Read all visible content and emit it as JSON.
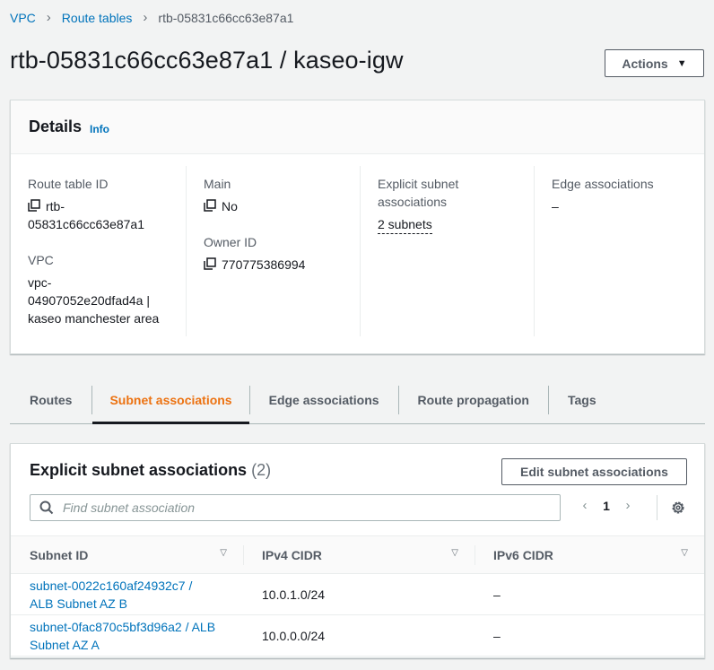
{
  "breadcrumb": {
    "items": [
      "VPC",
      "Route tables"
    ],
    "current": "rtb-05831c66cc63e87a1"
  },
  "page": {
    "title": "rtb-05831c66cc63e87a1 / kaseo-igw",
    "actions_label": "Actions"
  },
  "details": {
    "heading": "Details",
    "info_label": "Info",
    "route_table_id_label": "Route table ID",
    "route_table_id_line1": "rtb-",
    "route_table_id_line2": "05831c66cc63e87a1",
    "vpc_label": "VPC",
    "vpc_line1": "vpc-",
    "vpc_line2": "04907052e20dfad4a |",
    "vpc_line3": "kaseo manchester area",
    "main_label": "Main",
    "main_value": "No",
    "owner_id_label": "Owner ID",
    "owner_id_value": "770775386994",
    "explicit_label_line1": "Explicit subnet",
    "explicit_label_line2": "associations",
    "explicit_value": "2 subnets",
    "edge_label": "Edge associations",
    "edge_value": "–"
  },
  "tabs": [
    {
      "label": "Routes",
      "active": false
    },
    {
      "label": "Subnet associations",
      "active": true
    },
    {
      "label": "Edge associations",
      "active": false
    },
    {
      "label": "Route propagation",
      "active": false
    },
    {
      "label": "Tags",
      "active": false
    }
  ],
  "subnets": {
    "heading": "Explicit subnet associations",
    "count": "(2)",
    "edit_label": "Edit subnet associations",
    "search_placeholder": "Find subnet association",
    "page_number": "1",
    "columns": [
      "Subnet ID",
      "IPv4 CIDR",
      "IPv6 CIDR"
    ],
    "rows": [
      {
        "subnet_line1": "subnet-0022c160af24932c7 /",
        "subnet_line2": "ALB Subnet AZ B",
        "ipv4": "10.0.1.0/24",
        "ipv6": "–"
      },
      {
        "subnet_line1": "subnet-0fac870c5bf3d96a2 / ALB",
        "subnet_line2": "Subnet AZ A",
        "ipv4": "10.0.0.0/24",
        "ipv6": "–"
      }
    ]
  },
  "icons": {
    "copy": "copy-icon",
    "search": "search-icon",
    "settings": "gear-icon",
    "caret": "caret-down-icon",
    "sort": "sort-icon"
  },
  "colors": {
    "link": "#0073bb",
    "active_tab": "#ec7211",
    "background": "#f2f3f3"
  }
}
